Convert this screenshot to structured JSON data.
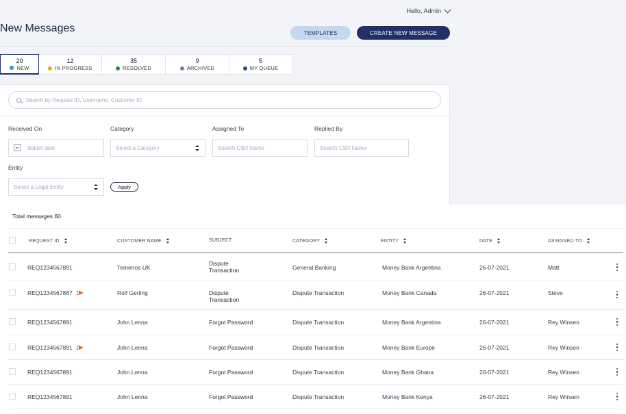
{
  "header": {
    "greeting": "Hello, Admin",
    "title": "New Messages",
    "templates_label": "TEMPLATES",
    "create_label": "CREATE NEW MESSAGE"
  },
  "colors": {
    "primary": "#22306a",
    "templates_bg": "#c6d8f0",
    "flag": "#e85a1a"
  },
  "tabs": [
    {
      "count": "20",
      "label": "NEW",
      "dot": "#1a9bd7"
    },
    {
      "count": "12",
      "label": "IN PROGRESS",
      "dot": "#f5a623"
    },
    {
      "count": "35",
      "label": "RESOLVED",
      "dot": "#1e8a5a"
    },
    {
      "count": "9",
      "label": "ARCHIVED",
      "dot": "#7a7f88"
    },
    {
      "count": "5",
      "label": "MY QUEUE",
      "dot": "#1f4e8c"
    }
  ],
  "filters": {
    "search_placeholder": "Search by Request ID, Username, Customer ID",
    "received_on_label": "Received On",
    "received_on_placeholder": "Select date",
    "category_label": "Category",
    "category_placeholder": "Select a Category",
    "assigned_to_label": "Assigned To",
    "assigned_to_placeholder": "Search CSR Name",
    "replied_by_label": "Replied By",
    "replied_by_placeholder": "Search CSR Name",
    "entity_label": "Entity",
    "entity_placeholder": "Select a Legal Entity",
    "apply_label": "Apply"
  },
  "table": {
    "total": "Total messages 60",
    "columns": [
      "REQUEST ID",
      "CUSTOMER NAME",
      "SUBJECT",
      "CATEGORY",
      "ENTITY",
      "DATE",
      "ASSIGNED TO"
    ],
    "rows": [
      {
        "request_id": "REQ1234567891",
        "flagged": false,
        "customer": "Temenos UK",
        "subject_1": "Dispute",
        "subject_2": "Transaction",
        "category": "General Banking",
        "entity": "Money Bank Argentina",
        "date": "26-07-2021",
        "assigned": "Matt"
      },
      {
        "request_id": "REQ1234567867",
        "flagged": true,
        "customer": "Rolf Gerling",
        "subject_1": "Dispute",
        "subject_2": "Transaction",
        "category": "Dispute Transaction",
        "entity": "Money Bank Canada",
        "date": "26-07-2021",
        "assigned": "Steve"
      },
      {
        "request_id": "REQ1234567891",
        "flagged": false,
        "customer": "John Lenna",
        "subject_1": "Forgot Password",
        "subject_2": "",
        "category": "Dispute Transaction",
        "entity": "Money Bank Argentina",
        "date": "26-07-2021",
        "assigned": "Rey Winsen"
      },
      {
        "request_id": "REQ1234567891",
        "flagged": true,
        "customer": "John Lenna",
        "subject_1": "Forgot Password",
        "subject_2": "",
        "category": "Dispute Transaction",
        "entity": "Money Bank Europe",
        "date": "26-07-2021",
        "assigned": "Rey Winsen"
      },
      {
        "request_id": "REQ1234567891",
        "flagged": false,
        "customer": "John Lenna",
        "subject_1": "Forgot Password",
        "subject_2": "",
        "category": "Dispute Transaction",
        "entity": "Money Bank Ghana",
        "date": "26-07-2021",
        "assigned": "Rey Winsen"
      },
      {
        "request_id": "REQ1234567891",
        "flagged": false,
        "customer": "John Lenna",
        "subject_1": "Forgot Password",
        "subject_2": "",
        "category": "Dispute Transaction",
        "entity": "Money Bank Kenya",
        "date": "26-07-2021",
        "assigned": "Rey Winsen"
      }
    ]
  }
}
